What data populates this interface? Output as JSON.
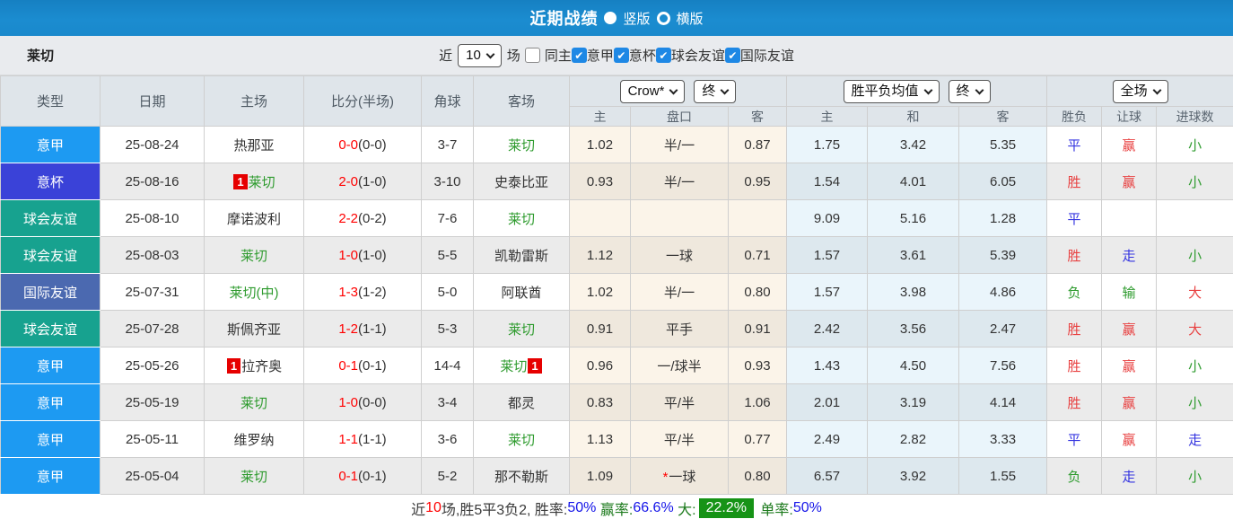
{
  "topbar": {
    "title": "近期战绩",
    "radio_selected_label": "竖版",
    "radio_unselected_label": "横版"
  },
  "filterbar": {
    "team": "莱切",
    "near_label": "近",
    "count_value": "10",
    "games_label": "场",
    "same_home_label": "同主",
    "leagues": [
      "意甲",
      "意杯",
      "球会友谊",
      "国际友谊"
    ]
  },
  "table": {
    "main_headers": [
      "类型",
      "日期",
      "主场",
      "比分(半场)",
      "角球",
      "客场"
    ],
    "dropdowns": {
      "odds_company": "Crow*",
      "odds_time": "终",
      "avg_label": "胜平负均值",
      "avg_time": "终",
      "fullmatch": "全场"
    },
    "sub_headers": [
      "主",
      "盘口",
      "客",
      "主",
      "和",
      "客",
      "胜负",
      "让球",
      "进球数"
    ],
    "type_colors": {
      "意甲": "#1d9af2",
      "意杯": "#3a42d8",
      "球会友谊": "#17a28f",
      "国际友谊": "#4b69b0"
    },
    "rows": [
      {
        "type": "意甲",
        "date": "25-08-24",
        "home": {
          "name": "热那亚",
          "green": false,
          "badge": null
        },
        "score_ft": "0-0",
        "score_ht": "(0-0)",
        "corners": "3-7",
        "away": {
          "name": "莱切",
          "green": true,
          "badge": null
        },
        "odds_home": "1.02",
        "handicap": "半/一",
        "handicap_star": false,
        "odds_away": "0.87",
        "avg_home": "1.75",
        "avg_draw": "3.42",
        "avg_away": "5.35",
        "res_wdl": {
          "t": "平",
          "c": "blue"
        },
        "res_handicap": {
          "t": "赢",
          "c": "red"
        },
        "res_goals": {
          "t": "小",
          "c": "green"
        }
      },
      {
        "type": "意杯",
        "date": "25-08-16",
        "home": {
          "name": "莱切",
          "green": true,
          "badge": "before"
        },
        "score_ft": "2-0",
        "score_ht": "(1-0)",
        "corners": "3-10",
        "away": {
          "name": "史泰比亚",
          "green": false,
          "badge": null
        },
        "odds_home": "0.93",
        "handicap": "半/一",
        "handicap_star": false,
        "odds_away": "0.95",
        "avg_home": "1.54",
        "avg_draw": "4.01",
        "avg_away": "6.05",
        "res_wdl": {
          "t": "胜",
          "c": "red"
        },
        "res_handicap": {
          "t": "赢",
          "c": "red"
        },
        "res_goals": {
          "t": "小",
          "c": "green"
        }
      },
      {
        "type": "球会友谊",
        "date": "25-08-10",
        "home": {
          "name": "摩诺波利",
          "green": false,
          "badge": null
        },
        "score_ft": "2-2",
        "score_ht": "(0-2)",
        "corners": "7-6",
        "away": {
          "name": "莱切",
          "green": true,
          "badge": null
        },
        "odds_home": "",
        "handicap": "",
        "handicap_star": false,
        "odds_away": "",
        "avg_home": "9.09",
        "avg_draw": "5.16",
        "avg_away": "1.28",
        "res_wdl": {
          "t": "平",
          "c": "blue"
        },
        "res_handicap": {
          "t": "",
          "c": ""
        },
        "res_goals": {
          "t": "",
          "c": ""
        }
      },
      {
        "type": "球会友谊",
        "date": "25-08-03",
        "home": {
          "name": "莱切",
          "green": true,
          "badge": null
        },
        "score_ft": "1-0",
        "score_ht": "(1-0)",
        "corners": "5-5",
        "away": {
          "name": "凯勒雷斯",
          "green": false,
          "badge": null
        },
        "odds_home": "1.12",
        "handicap": "一球",
        "handicap_star": false,
        "odds_away": "0.71",
        "avg_home": "1.57",
        "avg_draw": "3.61",
        "avg_away": "5.39",
        "res_wdl": {
          "t": "胜",
          "c": "red"
        },
        "res_handicap": {
          "t": "走",
          "c": "blue"
        },
        "res_goals": {
          "t": "小",
          "c": "green"
        }
      },
      {
        "type": "国际友谊",
        "date": "25-07-31",
        "home": {
          "name": "莱切(中)",
          "green": true,
          "badge": null
        },
        "score_ft": "1-3",
        "score_ht": "(1-2)",
        "corners": "5-0",
        "away": {
          "name": "阿联酋",
          "green": false,
          "badge": null
        },
        "odds_home": "1.02",
        "handicap": "半/一",
        "handicap_star": false,
        "odds_away": "0.80",
        "avg_home": "1.57",
        "avg_draw": "3.98",
        "avg_away": "4.86",
        "res_wdl": {
          "t": "负",
          "c": "green"
        },
        "res_handicap": {
          "t": "输",
          "c": "green"
        },
        "res_goals": {
          "t": "大",
          "c": "red"
        }
      },
      {
        "type": "球会友谊",
        "date": "25-07-28",
        "home": {
          "name": "斯佩齐亚",
          "green": false,
          "badge": null
        },
        "score_ft": "1-2",
        "score_ht": "(1-1)",
        "corners": "5-3",
        "away": {
          "name": "莱切",
          "green": true,
          "badge": null
        },
        "odds_home": "0.91",
        "handicap": "平手",
        "handicap_star": false,
        "odds_away": "0.91",
        "avg_home": "2.42",
        "avg_draw": "3.56",
        "avg_away": "2.47",
        "res_wdl": {
          "t": "胜",
          "c": "red"
        },
        "res_handicap": {
          "t": "赢",
          "c": "red"
        },
        "res_goals": {
          "t": "大",
          "c": "red"
        }
      },
      {
        "type": "意甲",
        "date": "25-05-26",
        "home": {
          "name": "拉齐奥",
          "green": false,
          "badge": "before"
        },
        "score_ft": "0-1",
        "score_ht": "(0-1)",
        "corners": "14-4",
        "away": {
          "name": "莱切",
          "green": true,
          "badge": "after"
        },
        "odds_home": "0.96",
        "handicap": "一/球半",
        "handicap_star": false,
        "odds_away": "0.93",
        "avg_home": "1.43",
        "avg_draw": "4.50",
        "avg_away": "7.56",
        "res_wdl": {
          "t": "胜",
          "c": "red"
        },
        "res_handicap": {
          "t": "赢",
          "c": "red"
        },
        "res_goals": {
          "t": "小",
          "c": "green"
        }
      },
      {
        "type": "意甲",
        "date": "25-05-19",
        "home": {
          "name": "莱切",
          "green": true,
          "badge": null
        },
        "score_ft": "1-0",
        "score_ht": "(0-0)",
        "corners": "3-4",
        "away": {
          "name": "都灵",
          "green": false,
          "badge": null
        },
        "odds_home": "0.83",
        "handicap": "平/半",
        "handicap_star": false,
        "odds_away": "1.06",
        "avg_home": "2.01",
        "avg_draw": "3.19",
        "avg_away": "4.14",
        "res_wdl": {
          "t": "胜",
          "c": "red"
        },
        "res_handicap": {
          "t": "赢",
          "c": "red"
        },
        "res_goals": {
          "t": "小",
          "c": "green"
        }
      },
      {
        "type": "意甲",
        "date": "25-05-11",
        "home": {
          "name": "维罗纳",
          "green": false,
          "badge": null
        },
        "score_ft": "1-1",
        "score_ht": "(1-1)",
        "corners": "3-6",
        "away": {
          "name": "莱切",
          "green": true,
          "badge": null
        },
        "odds_home": "1.13",
        "handicap": "平/半",
        "handicap_star": false,
        "odds_away": "0.77",
        "avg_home": "2.49",
        "avg_draw": "2.82",
        "avg_away": "3.33",
        "res_wdl": {
          "t": "平",
          "c": "blue"
        },
        "res_handicap": {
          "t": "赢",
          "c": "red"
        },
        "res_goals": {
          "t": "走",
          "c": "blue"
        }
      },
      {
        "type": "意甲",
        "date": "25-05-04",
        "home": {
          "name": "莱切",
          "green": true,
          "badge": null
        },
        "score_ft": "0-1",
        "score_ht": "(0-1)",
        "corners": "5-2",
        "away": {
          "name": "那不勒斯",
          "green": false,
          "badge": null
        },
        "odds_home": "1.09",
        "handicap": "一球",
        "handicap_star": true,
        "odds_away": "0.80",
        "avg_home": "6.57",
        "avg_draw": "3.92",
        "avg_away": "1.55",
        "res_wdl": {
          "t": "负",
          "c": "green"
        },
        "res_handicap": {
          "t": "走",
          "c": "blue"
        },
        "res_goals": {
          "t": "小",
          "c": "green"
        }
      }
    ],
    "badge_char": "1"
  },
  "summary": {
    "segments": [
      {
        "t": "近",
        "c": "dark"
      },
      {
        "t": "10",
        "c": "red"
      },
      {
        "t": "场,胜5平3负2, 胜率:",
        "c": "dark"
      },
      {
        "t": "50%",
        "c": "blue"
      },
      {
        "t": " 赢率:",
        "c": "greenlbl"
      },
      {
        "t": "66.6%",
        "c": "blue"
      },
      {
        "t": " 大:",
        "c": "greenlbl"
      },
      {
        "t": "22.2%",
        "c": "greenbox"
      },
      {
        "t": " 单率:",
        "c": "greenlbl"
      },
      {
        "t": "50%",
        "c": "blue"
      }
    ]
  }
}
